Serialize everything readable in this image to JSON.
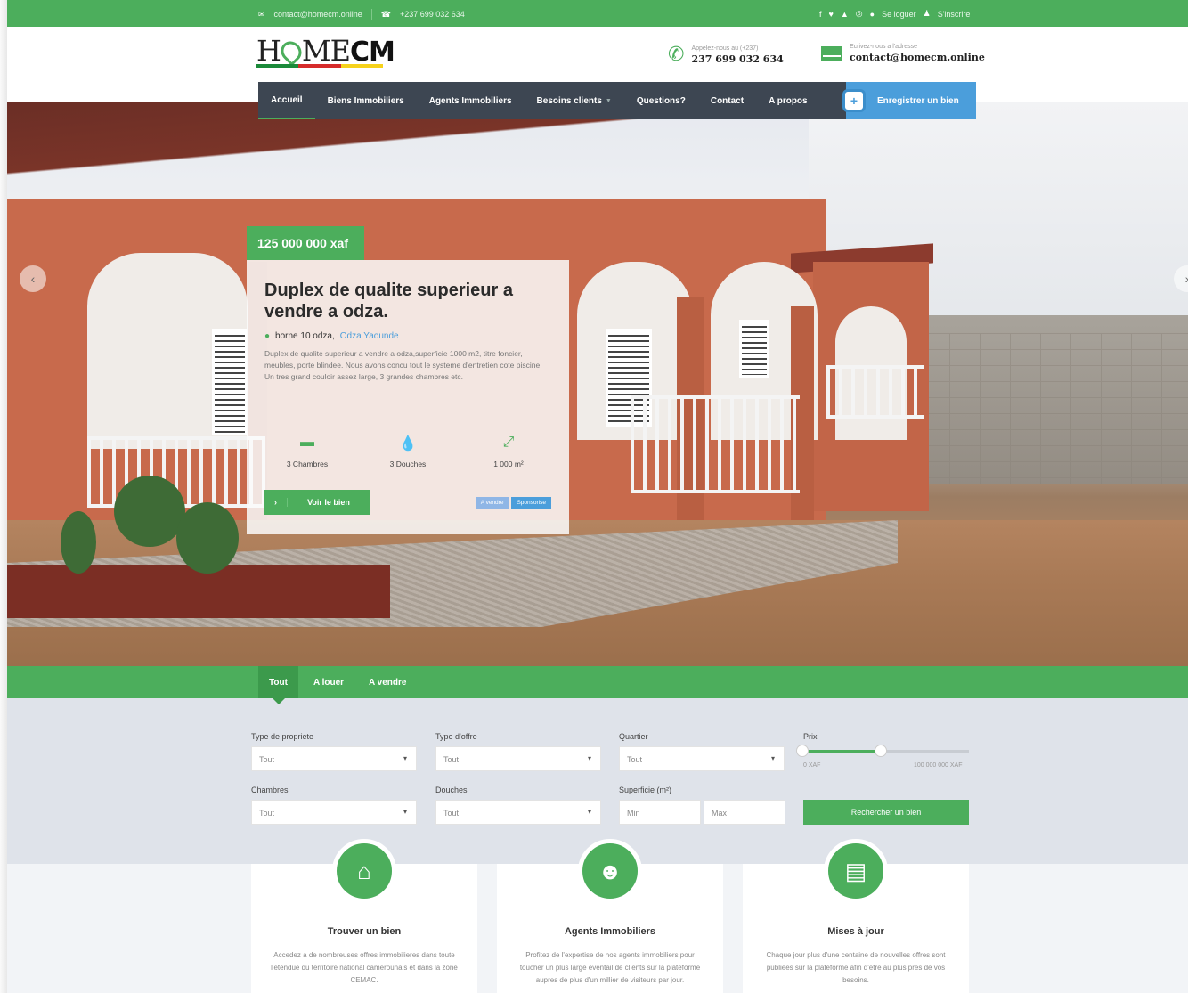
{
  "topbar": {
    "email": "contact@homecm.online",
    "phone": "+237 699 032 634",
    "login": "Se loguer",
    "register": "S'inscrire"
  },
  "header": {
    "logo_left": "H",
    "logo_mid": "ME",
    "logo_right": "CM",
    "call_label": "Appelez-nous au (+237)",
    "call_value": "237 699 032 634",
    "mail_label": "Ecrivez-nous a l'adresse",
    "mail_value": "contact@homecm.online",
    "flag_colors": [
      "#1b8a3a",
      "#d62b2b",
      "#f6d21b"
    ]
  },
  "nav": {
    "items": [
      {
        "label": "Accueil"
      },
      {
        "label": "Biens Immobiliers"
      },
      {
        "label": "Agents Immobiliers"
      },
      {
        "label": "Besoins clients"
      },
      {
        "label": "Questions?"
      },
      {
        "label": "Contact"
      },
      {
        "label": "A propos"
      }
    ],
    "cta_label": "Enregistrer un bien"
  },
  "hero": {
    "price": "125 000 000 xaf",
    "title": "Duplex de qualite superieur a vendre a odza.",
    "location": "borne 10 odza,",
    "city": "Odza Yaounde",
    "description": "Duplex de qualite superieur a vendre a odza,superficie 1000 m2, titre foncier, meubles, porte blindee. Nous avons concu tout le systeme d'entretien cote piscine. Un tres grand couloir assez large, 3 grandes chambres etc.",
    "features": [
      {
        "icon": "bed-icon",
        "label": "3 Chambres"
      },
      {
        "icon": "drop-icon",
        "label": "3 Douches"
      },
      {
        "icon": "expand-icon",
        "label": "1 000 m²"
      }
    ],
    "button_label": "Voir le bien",
    "badges": [
      {
        "label": "A vendre",
        "color": "#8fb6e6"
      },
      {
        "label": "Sponsorise",
        "color": "#4b9edb"
      }
    ]
  },
  "tabs": [
    {
      "label": "Tout"
    },
    {
      "label": "A louer"
    },
    {
      "label": "A vendre"
    }
  ],
  "search": {
    "property_type_label": "Type de propriete",
    "property_type_value": "Tout",
    "offer_type_label": "Type d'offre",
    "offer_type_value": "Tout",
    "district_label": "Quartier",
    "district_value": "Tout",
    "price_label": "Prix",
    "price_min": "0 XAF",
    "price_max": "100 000 000 XAF",
    "rooms_label": "Chambres",
    "rooms_value": "Tout",
    "showers_label": "Douches",
    "showers_value": "Tout",
    "area_label": "Superficie (m²)",
    "area_min_placeholder": "Min",
    "area_max_placeholder": "Max",
    "submit_label": "Rechercher un bien"
  },
  "features": [
    {
      "icon": "home-icon",
      "title": "Trouver un bien",
      "text": "Accedez a de nombreuses offres immobilieres dans toute l'etendue du territoire national camerounais et dans la zone CEMAC."
    },
    {
      "icon": "users-icon",
      "title": "Agents Immobiliers",
      "text": "Profitez de l'expertise de nos agents immobiliers pour toucher un plus large eventail de clients sur la plateforme aupres de plus d'un millier de visiteurs par jour."
    },
    {
      "icon": "document-icon",
      "title": "Mises à jour",
      "text": "Chaque jour plus d'une centaine de nouvelles offres sont publiees sur la plateforme afin d'etre au plus pres de vos besoins."
    }
  ]
}
